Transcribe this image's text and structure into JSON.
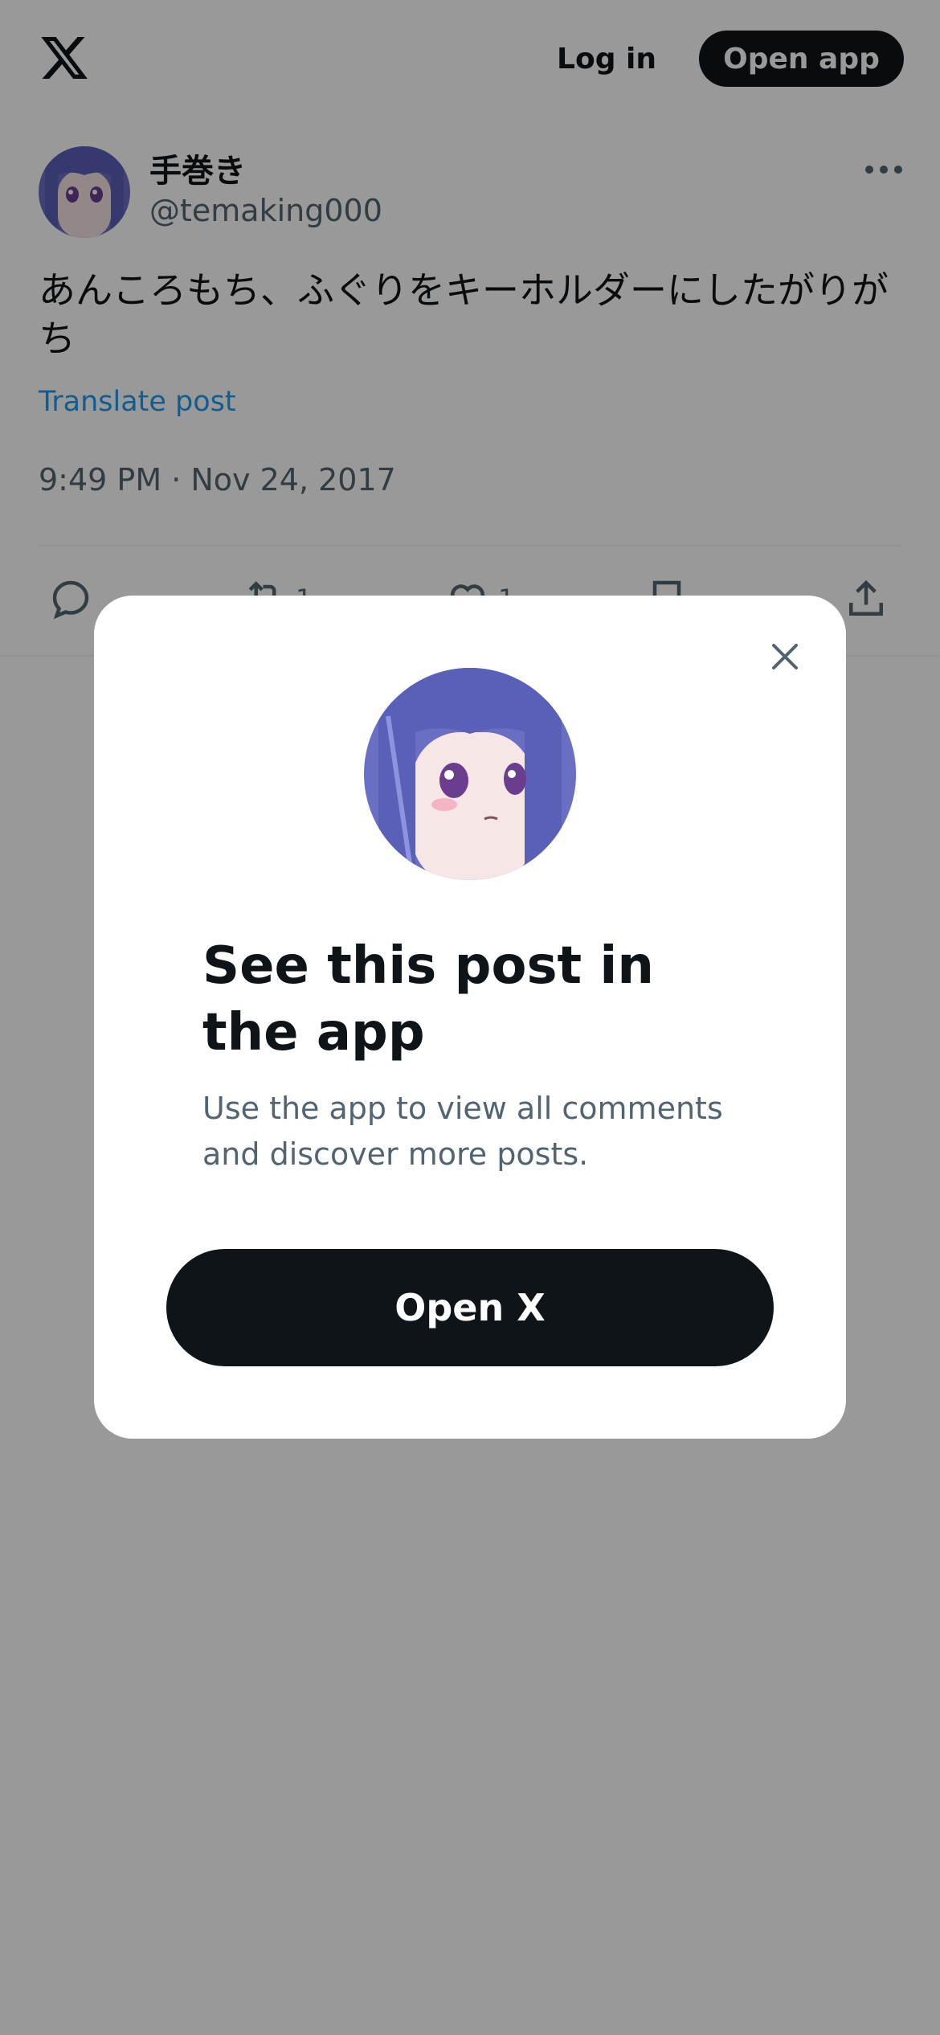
{
  "header": {
    "logo_icon": "x-logo-icon",
    "login_label": "Log in",
    "open_app_label": "Open app"
  },
  "post": {
    "display_name": "手巻き",
    "handle": "@temaking000",
    "text": "あんころもち、ふぐりをキーホルダーにしたがりがち",
    "translate_label": "Translate post",
    "timestamp": "9:49 PM · Nov 24, 2017",
    "more_icon": "ellipsis-icon"
  },
  "actions": {
    "reply_icon": "reply-icon",
    "repost_icon": "repost-icon",
    "repost_count": "1",
    "like_icon": "heart-icon",
    "like_count": "1",
    "bookmark_icon": "bookmark-icon",
    "share_icon": "share-icon"
  },
  "modal": {
    "close_icon": "close-icon",
    "title": "See this post in the app",
    "subtitle": "Use the app to view all comments and discover more posts.",
    "button_label": "Open X"
  },
  "colors": {
    "brand_dark": "#0f1419",
    "link": "#1d9bf0",
    "muted": "#536471",
    "overlay": "rgba(0,0,0,0.4)"
  }
}
